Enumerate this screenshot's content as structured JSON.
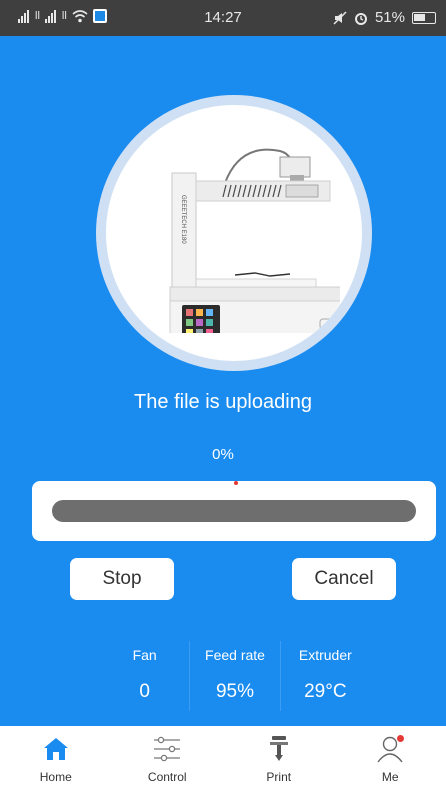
{
  "status_bar": {
    "time": "14:27",
    "battery": "51%",
    "signal1_label": "ll",
    "signal2_label": "ll"
  },
  "upload": {
    "message": "The file is uploading",
    "progress_text": "0%",
    "progress_fraction": 0.0
  },
  "buttons": {
    "stop": "Stop",
    "cancel": "Cancel"
  },
  "stats": {
    "fan_label": "Fan",
    "fan_value": "0",
    "feed_label": "Feed rate",
    "feed_value": "95%",
    "extruder_label": "Extruder",
    "extruder_value": "29°C"
  },
  "nav": {
    "home": "Home",
    "control": "Control",
    "print": "Print",
    "me": "Me"
  },
  "colors": {
    "accent": "#1a8bef",
    "track": "#6e6e6e",
    "notification": "#e53935"
  },
  "icons": {
    "home": "home-icon",
    "control": "sliders-icon",
    "print": "nozzle-icon",
    "me": "user-icon"
  }
}
